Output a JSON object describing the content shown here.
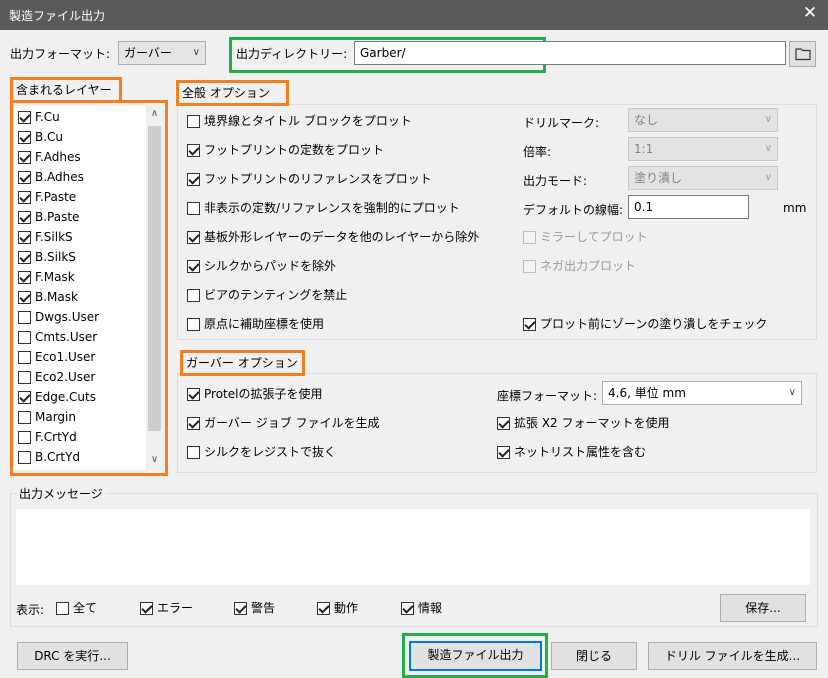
{
  "window": {
    "title": "製造ファイル出力",
    "close_icon": "✕"
  },
  "format": {
    "label": "出力フォーマット:",
    "value": "ガーバー"
  },
  "output_dir": {
    "label": "出力ディレクトリー:",
    "value": "Garber/",
    "browse_icon": "folder-icon"
  },
  "layers": {
    "title": "含まれるレイヤー",
    "items": [
      {
        "label": "F.Cu",
        "checked": true
      },
      {
        "label": "B.Cu",
        "checked": true
      },
      {
        "label": "F.Adhes",
        "checked": true
      },
      {
        "label": "B.Adhes",
        "checked": true
      },
      {
        "label": "F.Paste",
        "checked": true
      },
      {
        "label": "B.Paste",
        "checked": true
      },
      {
        "label": "F.SilkS",
        "checked": true
      },
      {
        "label": "B.SilkS",
        "checked": true
      },
      {
        "label": "F.Mask",
        "checked": true
      },
      {
        "label": "B.Mask",
        "checked": true
      },
      {
        "label": "Dwgs.User",
        "checked": false
      },
      {
        "label": "Cmts.User",
        "checked": false
      },
      {
        "label": "Eco1.User",
        "checked": false
      },
      {
        "label": "Eco2.User",
        "checked": false
      },
      {
        "label": "Edge.Cuts",
        "checked": true
      },
      {
        "label": "Margin",
        "checked": false
      },
      {
        "label": "F.CrtYd",
        "checked": false
      },
      {
        "label": "B.CrtYd",
        "checked": false
      }
    ]
  },
  "general": {
    "title": "全般 オプション",
    "options": [
      {
        "label": "境界線とタイトル ブロックをプロット",
        "checked": false
      },
      {
        "label": "フットプリントの定数をプロット",
        "checked": true
      },
      {
        "label": "フットプリントのリファレンスをプロット",
        "checked": true
      },
      {
        "label": "非表示の定数/リファレンスを強制的にプロット",
        "checked": false
      },
      {
        "label": "基板外形レイヤーのデータを他のレイヤーから除外",
        "checked": true
      },
      {
        "label": "シルクからパッドを除外",
        "checked": true
      },
      {
        "label": "ビアのテンティングを禁止",
        "checked": false
      },
      {
        "label": "原点に補助座標を使用",
        "checked": false
      }
    ],
    "drill_mark": {
      "label": "ドリルマーク:",
      "value": "なし"
    },
    "scale": {
      "label": "倍率:",
      "value": "1:1"
    },
    "output_mode": {
      "label": "出力モード:",
      "value": "塗り潰し"
    },
    "line_width": {
      "label": "デフォルトの線幅:",
      "value": "0.1",
      "unit": "mm"
    },
    "mirror": {
      "label": "ミラーしてプロット",
      "checked": false
    },
    "negative": {
      "label": "ネガ出力プロット",
      "checked": false
    },
    "check_zones": {
      "label": "プロット前にゾーンの塗り潰しをチェック",
      "checked": true
    }
  },
  "gerber": {
    "title": "ガーバー オプション",
    "protel": {
      "label": "Protelの拡張子を使用",
      "checked": true
    },
    "job_file": {
      "label": "ガーバー ジョブ ファイルを生成",
      "checked": true
    },
    "subtract_silk": {
      "label": "シルクをレジストで抜く",
      "checked": false
    },
    "coord_format": {
      "label": "座標フォーマット:",
      "value": "4.6, 単位 mm"
    },
    "x2": {
      "label": "拡張 X2 フォーマットを使用",
      "checked": true
    },
    "netlist": {
      "label": "ネットリスト属性を含む",
      "checked": true
    }
  },
  "messages": {
    "title": "出力メッセージ",
    "show_label": "表示:",
    "filters": [
      {
        "label": "全て",
        "checked": false
      },
      {
        "label": "エラー",
        "checked": true
      },
      {
        "label": "警告",
        "checked": true
      },
      {
        "label": "動作",
        "checked": true
      },
      {
        "label": "情報",
        "checked": true
      }
    ],
    "save_label": "保存..."
  },
  "buttons": {
    "drc": "DRC を実行...",
    "plot": "製造ファイル出力",
    "close": "閉じる",
    "drill": "ドリル ファイルを生成..."
  }
}
